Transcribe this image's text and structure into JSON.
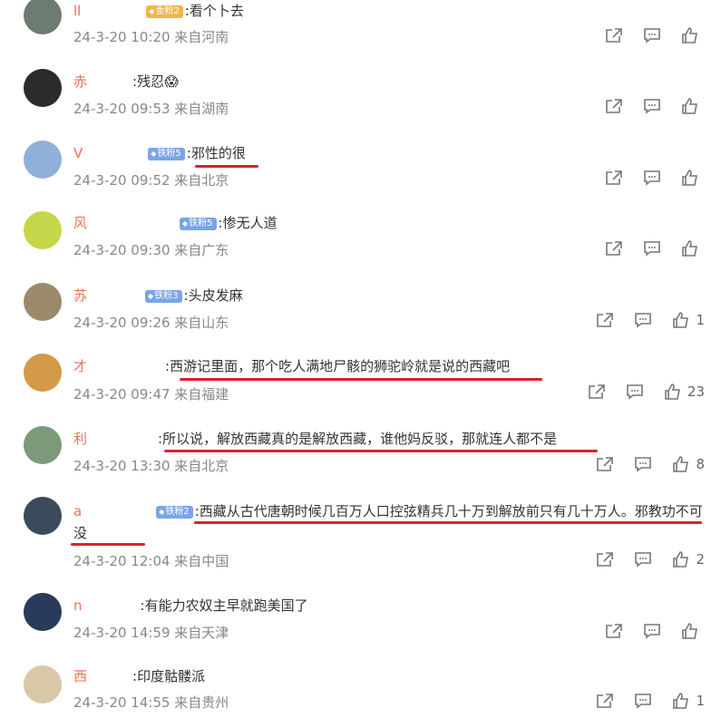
{
  "comments": [
    {
      "name": "ll",
      "badge": "金粉2",
      "badge_type": "gold",
      "text": ":看个卜去",
      "date": "24-3-20 10:20 来自河南",
      "likes": "",
      "avatar_color": "#6e7b70"
    },
    {
      "name": "赤",
      "badge": "",
      "badge_type": "",
      "text": ":残忍😱",
      "date": "24-3-20 09:53 来自湖南",
      "likes": "",
      "avatar_color": "#2b2b2b"
    },
    {
      "name": "V",
      "badge": "铁粉5",
      "badge_type": "iron",
      "text": ":邪性的很",
      "date": "24-3-20 09:52 来自北京",
      "likes": "",
      "avatar_color": "#8fb0d8"
    },
    {
      "name": "风",
      "badge": "铁粉5",
      "badge_type": "iron",
      "text": ":惨无人道",
      "date": "24-3-20 09:30 来自广东",
      "likes": "",
      "avatar_color": "#c6d64a"
    },
    {
      "name": "苏",
      "badge": "铁粉3",
      "badge_type": "iron",
      "text": ":头皮发麻",
      "date": "24-3-20 09:26 来自山东",
      "likes": "1",
      "avatar_color": "#9a8a6a"
    },
    {
      "name": "才",
      "badge": "",
      "badge_type": "",
      "text": ":西游记里面，那个吃人满地尸骸的狮驼岭就是说的西藏吧",
      "date": "24-3-20 09:47 来自福建",
      "likes": "23",
      "avatar_color": "#d49a4a"
    },
    {
      "name": "利",
      "badge": "",
      "badge_type": "",
      "text": ":所以说，解放西藏真的是解放西藏，谁他妈反驳，那就连人都不是",
      "date": "24-3-20 13:30 来自北京",
      "likes": "8",
      "avatar_color": "#7a9a7a"
    },
    {
      "name": "a",
      "badge": "铁粉2",
      "badge_type": "iron",
      "text": ":西藏从古代唐朝时候几百万人口控弦精兵几十万到解放前只有几十万人。邪教功不可没",
      "date": "24-3-20 12:04 来自中国",
      "likes": "2",
      "avatar_color": "#3a4a5a"
    },
    {
      "name": "n",
      "badge": "",
      "badge_type": "",
      "text": ":有能力农奴主早就跑美国了",
      "date": "24-3-20 14:59 来自天津",
      "likes": "",
      "avatar_color": "#2a3a5a"
    },
    {
      "name": "西",
      "badge": "",
      "badge_type": "",
      "text": ":印度骷髅派",
      "date": "24-3-20 14:55 来自贵州",
      "likes": "1",
      "avatar_color": "#d8c8a8"
    }
  ]
}
